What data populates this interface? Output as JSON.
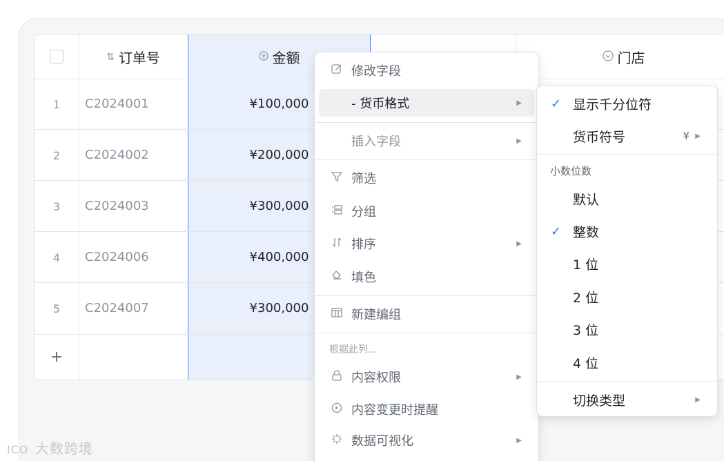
{
  "table": {
    "headers": {
      "order": {
        "icon": "sort-order-icon",
        "glyph": "⇅",
        "label": "订单号"
      },
      "amount": {
        "icon": "currency-icon",
        "glyph": "¥",
        "label": "金额"
      },
      "store": {
        "icon": "dropdown-circle-icon",
        "glyph": "⌄",
        "label": "门店"
      }
    },
    "rows": [
      {
        "num": "1",
        "order": "C2024001",
        "amount": "¥100,000"
      },
      {
        "num": "2",
        "order": "C2024002",
        "amount": "¥200,000"
      },
      {
        "num": "3",
        "order": "C2024003",
        "amount": "¥300,000"
      },
      {
        "num": "4",
        "order": "C2024006",
        "amount": "¥400,000"
      },
      {
        "num": "5",
        "order": "C2024007",
        "amount": "¥300,000"
      }
    ],
    "add_row": "+"
  },
  "context_menu": {
    "modify_field": "修改字段",
    "currency_format": "- 货币格式",
    "insert_field": "插入字段",
    "filter": "筛选",
    "group": "分组",
    "sort": "排序",
    "fill_color": "填色",
    "new_group": "新建编组",
    "based_on_column": "根据此列...",
    "content_permission": "内容权限",
    "change_reminder": "内容变更时提醒",
    "data_visualization": "数据可视化"
  },
  "submenu": {
    "thousands_separator": "显示千分位符",
    "currency_symbol": "货币符号",
    "currency_symbol_value": "¥",
    "decimal_places_title": "小数位数",
    "default": "默认",
    "integer": "整数",
    "one": "1 位",
    "two": "2 位",
    "three": "3 位",
    "four": "4 位",
    "switch_type": "切换类型",
    "checked": [
      "显示千分位符",
      "整数"
    ]
  },
  "watermark": {
    "text": "大数跨境",
    "logo": "ICO"
  },
  "colors": {
    "accent": "#3370ff",
    "selection_fill": "#e9f0fc",
    "selection_border": "#4a84e8"
  }
}
